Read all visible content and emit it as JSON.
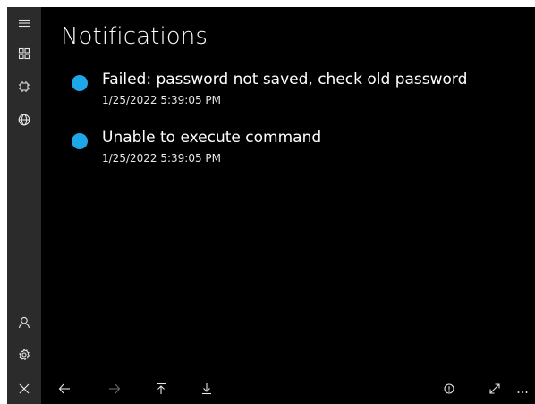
{
  "page": {
    "title": "Notifications"
  },
  "sidebar": {
    "top_items": [
      {
        "icon": "hamburger-menu-icon"
      },
      {
        "icon": "grid-icon"
      },
      {
        "icon": "chip-icon"
      },
      {
        "icon": "globe-icon"
      }
    ],
    "bottom_items": [
      {
        "icon": "user-icon"
      },
      {
        "icon": "gear-icon"
      },
      {
        "icon": "close-icon"
      }
    ]
  },
  "notifications": [
    {
      "message": "Failed: password not saved, check old password",
      "timestamp": "1/25/2022 5:39:05 PM",
      "indicator_color": "#1ea7e8"
    },
    {
      "message": "Unable to execute command",
      "timestamp": "1/25/2022 5:39:05 PM",
      "indicator_color": "#1ea7e8"
    }
  ],
  "bottom_bar": {
    "left": [
      {
        "icon": "arrow-left-icon",
        "enabled": true
      },
      {
        "icon": "arrow-right-icon",
        "enabled": false
      },
      {
        "icon": "arrow-up-to-top-icon",
        "enabled": true
      },
      {
        "icon": "arrow-down-to-bottom-icon",
        "enabled": true
      }
    ],
    "right": [
      {
        "icon": "info-icon"
      },
      {
        "icon": "expand-icon"
      },
      {
        "icon": "more-icon"
      }
    ]
  },
  "colors": {
    "background": "#000000",
    "sidebar": "#2b2b2b",
    "accent": "#1ea7e8",
    "text": "#ffffff"
  }
}
